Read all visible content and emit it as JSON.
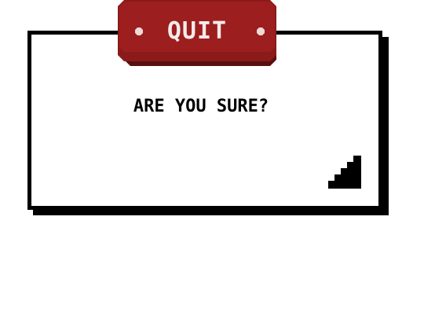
{
  "dialog": {
    "title": "QUIT",
    "prompt": "ARE YOU SURE?",
    "corner_icon": "pixel-staircase-corner-icon"
  },
  "colors": {
    "title_bg": "#8b1a1a",
    "title_text": "#f5eaea",
    "dialog_bg": "#ffffff",
    "dialog_border": "#000000"
  }
}
